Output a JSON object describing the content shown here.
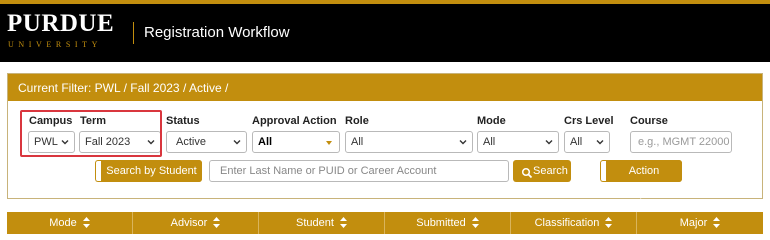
{
  "header": {
    "logo_word": "PURDUE",
    "logo_sub": "UNIVERSITY",
    "app_title": "Registration Workflow"
  },
  "panel": {
    "current_filter": "Current Filter: PWL / Fall 2023 / Active /"
  },
  "filters": {
    "campus": {
      "label": "Campus",
      "value": "PWL"
    },
    "term": {
      "label": "Term",
      "value": "Fall 2023"
    },
    "status": {
      "label": "Status",
      "value": "Active"
    },
    "approval_action": {
      "label": "Approval Action",
      "value": "All"
    },
    "role": {
      "label": "Role",
      "value": "All"
    },
    "mode": {
      "label": "Mode",
      "value": "All"
    },
    "crs_level": {
      "label": "Crs Level",
      "value": "All"
    },
    "course": {
      "label": "Course",
      "placeholder": "e.g., MGMT 22000"
    }
  },
  "search": {
    "by_student_label": "Search by Student",
    "input_placeholder": "Enter Last Name or PUID or Career Account",
    "button_label": "Search",
    "action_required_label": "Action Required"
  },
  "table": {
    "columns": [
      "Mode",
      "Advisor",
      "Student",
      "Submitted",
      "Classification",
      "Major"
    ]
  },
  "colors": {
    "gold": "#c28e0e",
    "highlight": "#d9363e"
  }
}
